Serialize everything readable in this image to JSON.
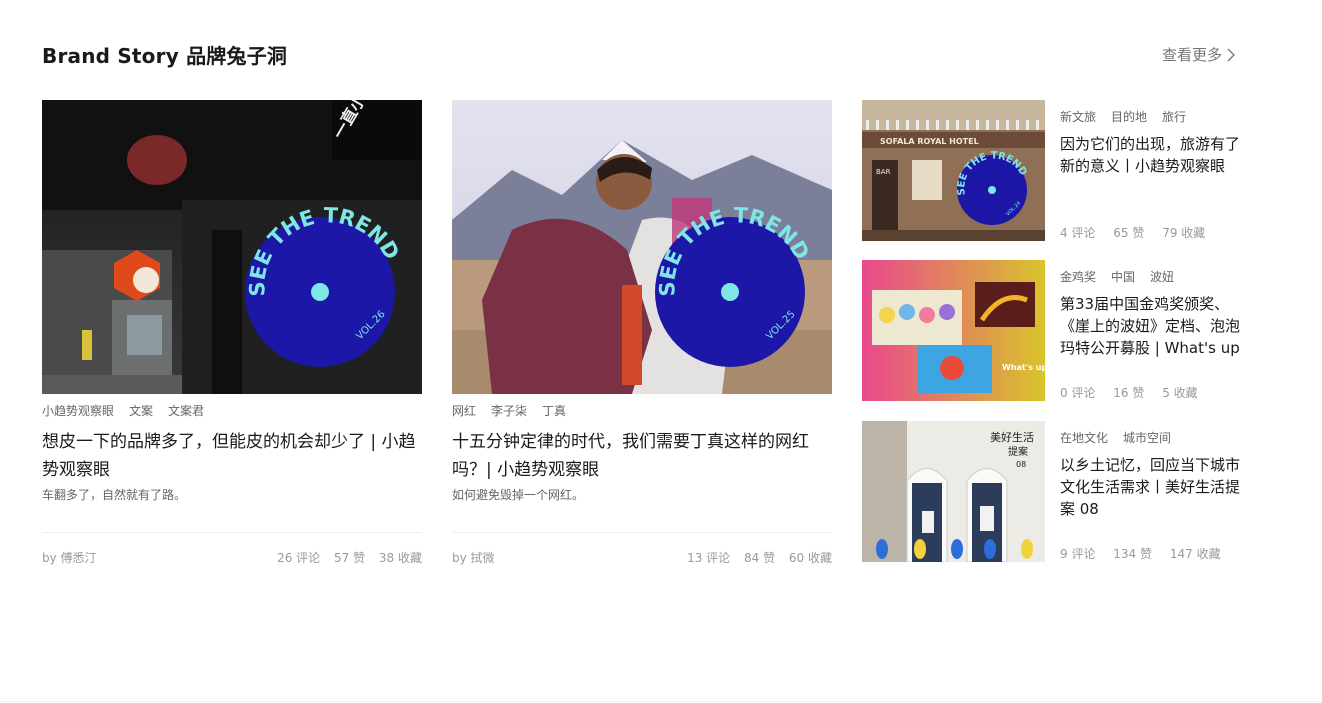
{
  "section": {
    "title": "Brand Story 品牌兔子洞",
    "more_label": "查看更多"
  },
  "badge": {
    "text": "SEE THE TREND",
    "color": "#1d17a8",
    "dot_color": "#7ee6e6"
  },
  "cards": [
    {
      "tags": [
        "小趋势观察眼",
        "文案",
        "文案君"
      ],
      "title": "想皮一下的品牌多了，但能皮的机会却少了 | 小趋势观察眼",
      "desc": "车翻多了，自然就有了路。",
      "author": "by 傅悉汀",
      "comments": "26 评论",
      "likes": "57 赞",
      "favorites": "38 收藏",
      "vol": "VOL.26"
    },
    {
      "tags": [
        "网红",
        "李子柒",
        "丁真"
      ],
      "title": "十五分钟定律的时代，我们需要丁真这样的网红吗？| 小趋势观察眼",
      "desc": "如何避免毁掉一个网红。",
      "author": "by 拭微",
      "comments": "13 评论",
      "likes": "84 赞",
      "favorites": "60 收藏",
      "vol": "VOL.25"
    }
  ],
  "side_items": [
    {
      "tags": [
        "新文旅",
        "目的地",
        "旅行"
      ],
      "title": "因为它们的出现，旅游有了新的意义丨小趋势观察眼",
      "comments": "4 评论",
      "likes": "65 赞",
      "favorites": "79 收藏",
      "sign": "SOFALA ROYAL HOTEL",
      "bar": "BAR",
      "vol": "VOL.24"
    },
    {
      "tags": [
        "金鸡奖",
        "中国",
        "波妞"
      ],
      "title": "第33届中国金鸡奖颁奖、《崖上的波妞》定档、泡泡玛特公开募股 | What's up",
      "comments": "0 评论",
      "likes": "16 赞",
      "favorites": "5 收藏",
      "stamp": "What's up ?"
    },
    {
      "tags": [
        "在地文化",
        "城市空间"
      ],
      "title": "以乡土记忆，回应当下城市文化生活需求丨美好生活提案 08",
      "comments": "9 评论",
      "likes": "134 赞",
      "favorites": "147 收藏",
      "sign_line1": "美好生活",
      "sign_line2": "提案",
      "sign_no": "08"
    }
  ]
}
